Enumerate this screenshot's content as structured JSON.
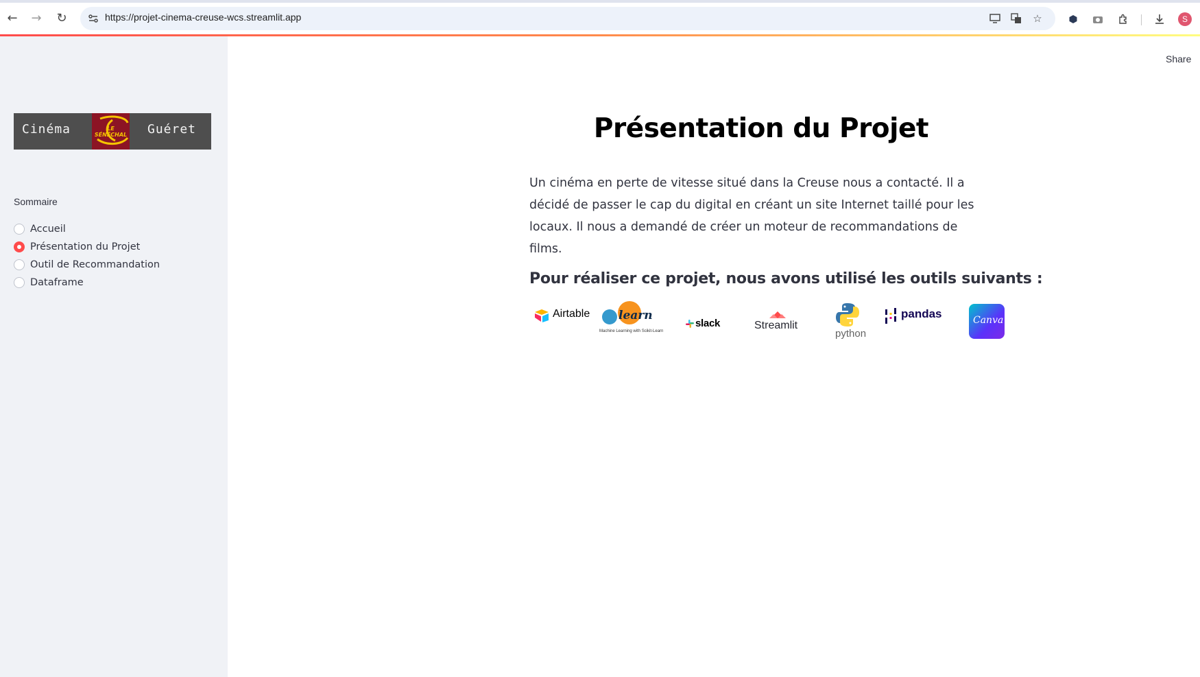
{
  "browser": {
    "url": "https://projet-cinema-creuse-wcs.streamlit.app",
    "profile_initial": "S"
  },
  "sidebar": {
    "logo": {
      "left_text": "Cinéma",
      "center_text": "LE SÉNÉCHAL",
      "right_text": "Guéret"
    },
    "nav_title": "Sommaire",
    "items": [
      {
        "label": "Accueil",
        "selected": false
      },
      {
        "label": "Présentation du Projet",
        "selected": true
      },
      {
        "label": "Outil de Recommandation",
        "selected": false
      },
      {
        "label": "Dataframe",
        "selected": false
      }
    ]
  },
  "header": {
    "share_label": "Share"
  },
  "main": {
    "title": "Présentation du Projet",
    "intro": "Un cinéma en perte de vitesse situé dans la Creuse nous a contacté. Il a décidé de passer le cap du digital en créant un site Internet taillé pour les locaux. Il nous a demandé de créer un moteur de recommandations de films.",
    "tools_heading": "Pour réaliser ce projet, nous avons utilisé les outils suivants :",
    "tools": [
      {
        "name": "Airtable",
        "color": "#000000"
      },
      {
        "name": "learn",
        "caption": "Machine Learning with Scikit-Learn",
        "color": "#f7931e"
      },
      {
        "name": "slack",
        "color": "#000000"
      },
      {
        "name": "Streamlit",
        "color": "#262730"
      },
      {
        "name": "python",
        "color": "#646464"
      },
      {
        "name": "pandas",
        "color": "#130654"
      },
      {
        "name": "Canva",
        "color": "#7d2ae8"
      }
    ]
  },
  "colors": {
    "accent": "#ff4b4b",
    "sidebar_bg": "#f0f2f6",
    "text": "#31333f"
  }
}
